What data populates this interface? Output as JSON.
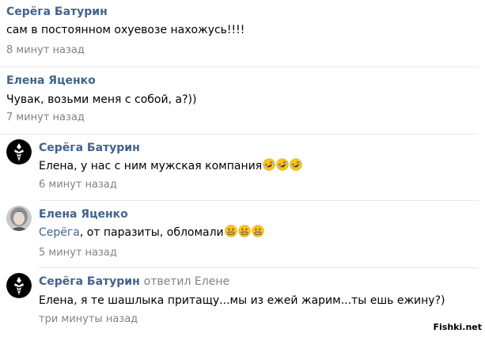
{
  "comments": [
    {
      "author": "Серёга Батурин",
      "text": "сам в постоянном охуевозе нахожусь!!!!",
      "time": "8 минут назад"
    },
    {
      "author": "Елена Яценко",
      "text": "Чувак, возьми меня с собой, а?))",
      "time": "7 минут назад"
    },
    {
      "author": "Серёга Батурин",
      "text": "Елена, у нас с ним мужская компания",
      "emoji": [
        "rofl-emoji",
        "rofl-emoji",
        "rofl-emoji"
      ],
      "time": "6 минут назад",
      "avatar": "tuxedo-avatar"
    },
    {
      "author": "Елена Яценко",
      "mention": "Серёга",
      "text": ", от паразиты, обломали",
      "emoji": [
        "grimace-emoji",
        "grimace-emoji",
        "grimace-emoji"
      ],
      "time": "5 минут назад",
      "avatar": "woman-photo-avatar"
    },
    {
      "author": "Серёга Батурин",
      "reply_to": "ответил Елене",
      "text": "Елена, я те шашлыка притащу...мы из ежей жарим...ты ешь ежину?)",
      "time": "три минуты назад",
      "avatar": "tuxedo-avatar"
    }
  ],
  "watermark": "Fishki.net",
  "colors": {
    "author": "#42648b",
    "meta": "#828282",
    "divider": "#e7e8ec",
    "emoji_face": "#fcc21b"
  }
}
